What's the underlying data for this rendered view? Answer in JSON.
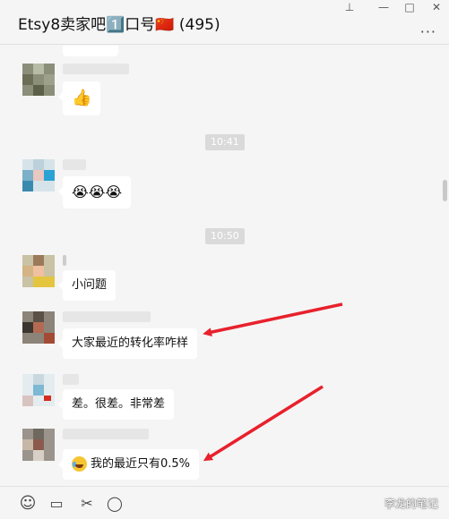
{
  "window": {
    "title": "Etsy8卖家吧1️⃣口号🇨🇳 (495)",
    "pin_icon": "pin-icon",
    "minimize_icon": "minimize-icon",
    "maximize_icon": "maximize-icon",
    "close_icon": "close-icon",
    "more_icon": "more-icon"
  },
  "messages": [
    {
      "type": "image-sticker",
      "icon": "thumbs-up-icon",
      "content": "👍"
    },
    {
      "type": "time",
      "text": "10:41"
    },
    {
      "type": "text",
      "content": "😭😭😭"
    },
    {
      "type": "time",
      "text": "10:50"
    },
    {
      "type": "text",
      "content": "小问题"
    },
    {
      "type": "text",
      "content": "大家最近的转化率咋样"
    },
    {
      "type": "text",
      "content": "差。很差。非常差"
    },
    {
      "type": "text",
      "content": "我的最近只有0.5%",
      "emoji": "tears-of-joy-emoji"
    }
  ],
  "toolbar": {
    "emoji": "☺",
    "folder": "▭",
    "scissors": "✂",
    "chat": "◯"
  },
  "watermark": "李龙的笔记",
  "colors": {
    "arrow": "#e8212c",
    "bubble": "#ffffff",
    "time_bg": "#dadada"
  }
}
